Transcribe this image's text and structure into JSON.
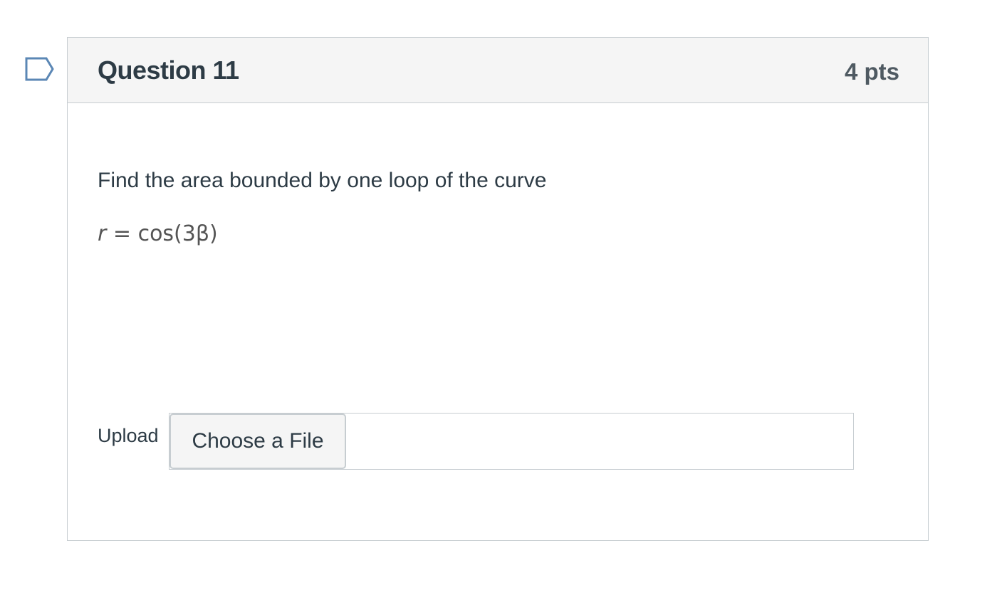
{
  "question": {
    "title": "Question 11",
    "points": "4 pts",
    "flag_icon": "flag-outline-icon",
    "text": "Find the area bounded by one loop of the curve",
    "equation": {
      "lhs": "r",
      "equals": "=",
      "rhs": "cos(3β)"
    }
  },
  "upload": {
    "label": "Upload",
    "button_label": "Choose a File",
    "selected_file": ""
  },
  "colors": {
    "header_bg": "#f5f5f5",
    "border": "#c7cdd1",
    "text": "#2d3b45",
    "flag_stroke": "#5b87b5"
  }
}
